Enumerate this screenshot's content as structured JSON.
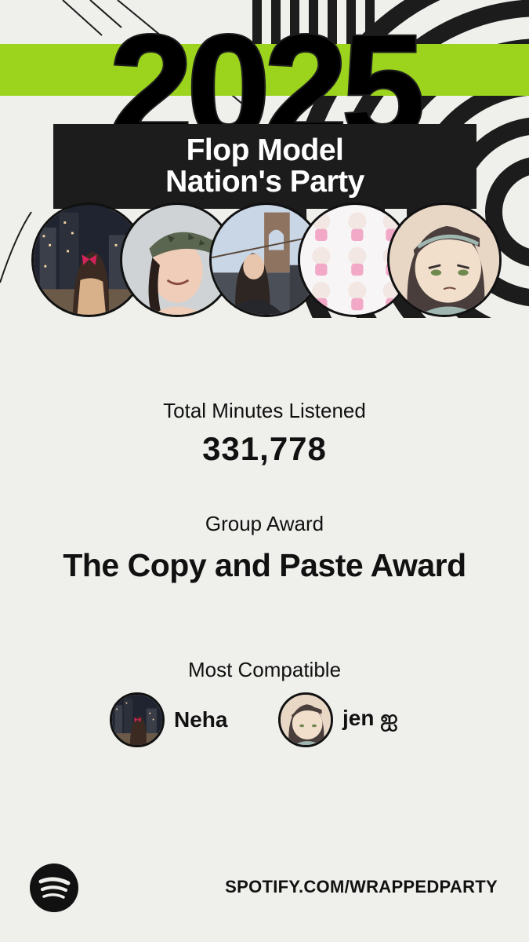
{
  "hero": {
    "year_text": "2025",
    "title_line1": "Flop Model",
    "title_line2": "Nation's Party",
    "accent_color": "#9bd31d",
    "stripe_color": "#1c1c1c",
    "members": [
      {
        "picture": "city-night-bow-photo"
      },
      {
        "picture": "camo-cap-selfie-photo"
      },
      {
        "picture": "bridge-selfie-photo"
      },
      {
        "picture": "pink-lamb-toys-pattern"
      },
      {
        "picture": "painted-girl-portrait"
      }
    ]
  },
  "stats": {
    "minutes_label": "Total Minutes Listened",
    "minutes_value": "331,778",
    "award_label": "Group Award",
    "award_value": "The Copy and Paste Award",
    "compat_label": "Most Compatible",
    "compat": [
      {
        "name": "Neha",
        "picture": "city-night-bow-photo"
      },
      {
        "name": "jen ஐ",
        "picture": "painted-girl-portrait"
      }
    ]
  },
  "footer": {
    "link": "SPOTIFY.COM/WRAPPEDPARTY",
    "logo_icon": "spotify-logo-icon"
  }
}
